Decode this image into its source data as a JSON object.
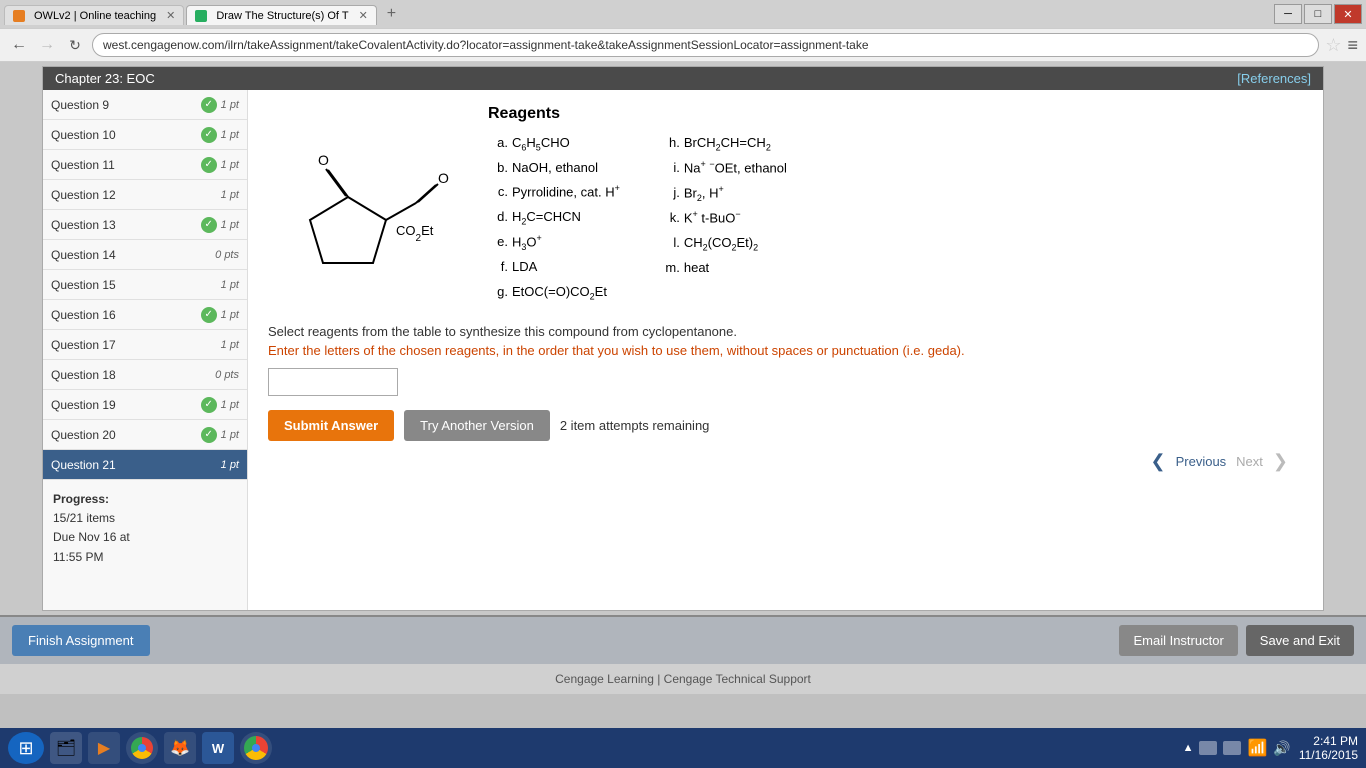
{
  "browser": {
    "tabs": [
      {
        "label": "OWLv2 | Online teaching",
        "icon": "owl",
        "active": false
      },
      {
        "label": "Draw The Structure(s) Of T",
        "icon": "cengage",
        "active": true
      }
    ],
    "url": "west.cengagenow.com/ilrn/takeAssignment/takeCovalentActivity.do?locator=assignment-take&takeAssignmentSessionLocator=assignment-take"
  },
  "chapter_header": {
    "title": "Chapter 23: EOC",
    "references_label": "[References]"
  },
  "sidebar": {
    "questions": [
      {
        "label": "Question 9",
        "checked": true,
        "pts": "1 pt"
      },
      {
        "label": "Question 10",
        "checked": true,
        "pts": "1 pt"
      },
      {
        "label": "Question 11",
        "checked": true,
        "pts": "1 pt"
      },
      {
        "label": "Question 12",
        "checked": false,
        "pts": "1 pt"
      },
      {
        "label": "Question 13",
        "checked": true,
        "pts": "1 pt"
      },
      {
        "label": "Question 14",
        "checked": false,
        "pts": "0 pts"
      },
      {
        "label": "Question 15",
        "checked": false,
        "pts": "1 pt"
      },
      {
        "label": "Question 16",
        "checked": true,
        "pts": "1 pt"
      },
      {
        "label": "Question 17",
        "checked": false,
        "pts": "1 pt"
      },
      {
        "label": "Question 18",
        "checked": false,
        "pts": "0 pts"
      },
      {
        "label": "Question 19",
        "checked": true,
        "pts": "1 pt"
      },
      {
        "label": "Question 20",
        "checked": true,
        "pts": "1 pt"
      },
      {
        "label": "Question 21",
        "checked": false,
        "pts": "1 pt",
        "active": true
      }
    ],
    "progress": {
      "label": "Progress:",
      "items": "15/21 items",
      "due": "Due Nov 16 at",
      "due_time": "11:55 PM"
    }
  },
  "reagents": {
    "title": "Reagents",
    "left_col": [
      {
        "letter": "a.",
        "text": "C₆H₅CHO"
      },
      {
        "letter": "b.",
        "text": "NaOH, ethanol"
      },
      {
        "letter": "c.",
        "text": "Pyrrolidine, cat. H⁺"
      },
      {
        "letter": "d.",
        "text": "H₂C=CHCN"
      },
      {
        "letter": "e.",
        "text": "H₃O⁺"
      },
      {
        "letter": "f.",
        "text": "LDA"
      },
      {
        "letter": "g.",
        "text": "EtOC(=O)CO₂Et"
      }
    ],
    "right_col": [
      {
        "letter": "h.",
        "text": "BrCH₂CH=CH₂"
      },
      {
        "letter": "i.",
        "text": "Na⁺ ⁻OEt, ethanol"
      },
      {
        "letter": "j.",
        "text": "Br₂, H⁺"
      },
      {
        "letter": "k.",
        "text": "K⁺ t-BuO⁻"
      },
      {
        "letter": "l.",
        "text": "CH₂(CO₂Et)₂"
      },
      {
        "letter": "m.",
        "text": "heat"
      }
    ]
  },
  "question": {
    "instruction": "Select reagents from the table to synthesize this compound from cyclopentanone.",
    "instruction_colored": "Enter the letters of the chosen reagents, in the order that you wish to use them, without spaces or punctuation (i.e. geda).",
    "answer_placeholder": "",
    "submit_label": "Submit Answer",
    "try_another_label": "Try Another Version",
    "attempts_text": "2 item attempts remaining"
  },
  "navigation": {
    "previous_label": "Previous",
    "next_label": "Next"
  },
  "footer_buttons": {
    "finish_label": "Finish Assignment",
    "email_label": "Email Instructor",
    "save_label": "Save and Exit"
  },
  "footer": {
    "text": "Cengage Learning | Cengage Technical Support"
  },
  "taskbar": {
    "time": "2:41 PM",
    "date": "11/16/2015"
  }
}
